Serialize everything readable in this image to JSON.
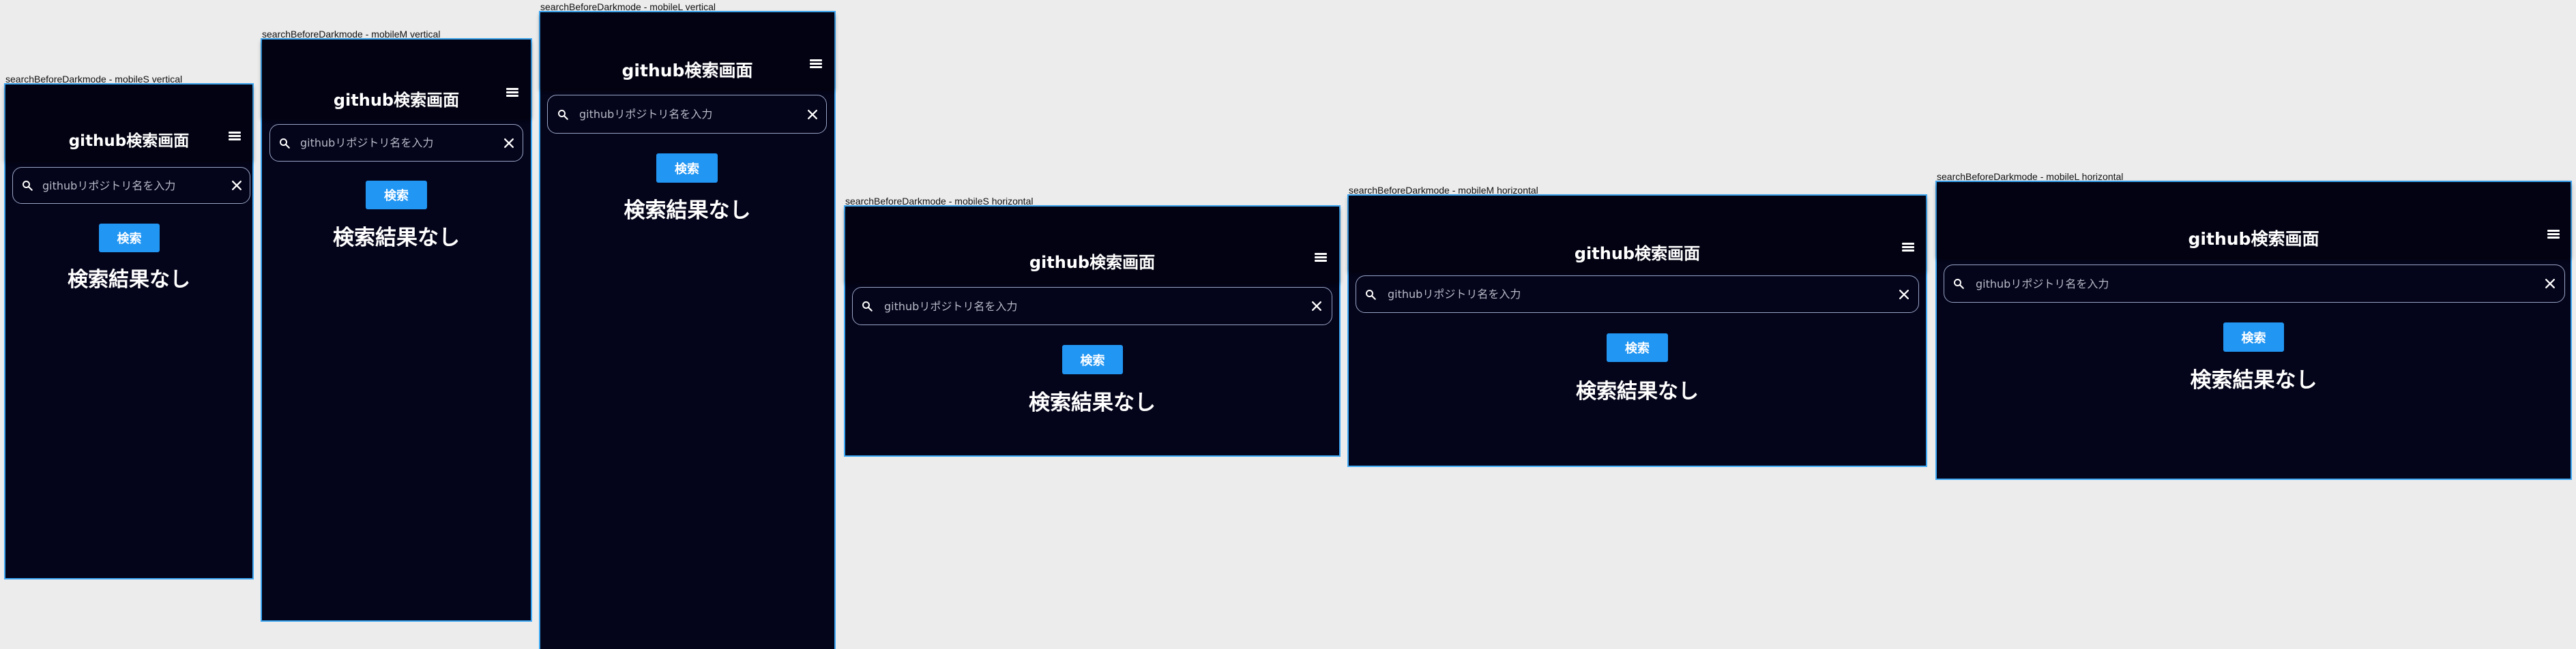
{
  "app": {
    "title": "github検索画面",
    "search_placeholder": "githubリポジトリ名を入力",
    "search_button_label": "検索",
    "no_results_text": "検索結果なし"
  },
  "icons": {
    "menu": "hamburger-menu-icon",
    "search": "magnifier-search-icon",
    "clear": "close-x-icon"
  },
  "colors": {
    "background": "#04041a",
    "header": "#020212",
    "accent": "#2196f3",
    "frame_outline": "#3da8f5",
    "canvas": "#ececec"
  },
  "frames": [
    {
      "label": "searchBeforeDarkmode - mobileS vertical"
    },
    {
      "label": "searchBeforeDarkmode - mobileM vertical"
    },
    {
      "label": "searchBeforeDarkmode - mobileL vertical"
    },
    {
      "label": "searchBeforeDarkmode - mobileS horizontal"
    },
    {
      "label": "searchBeforeDarkmode - mobileM horizontal"
    },
    {
      "label": "searchBeforeDarkmode - mobileL horizontal"
    }
  ]
}
